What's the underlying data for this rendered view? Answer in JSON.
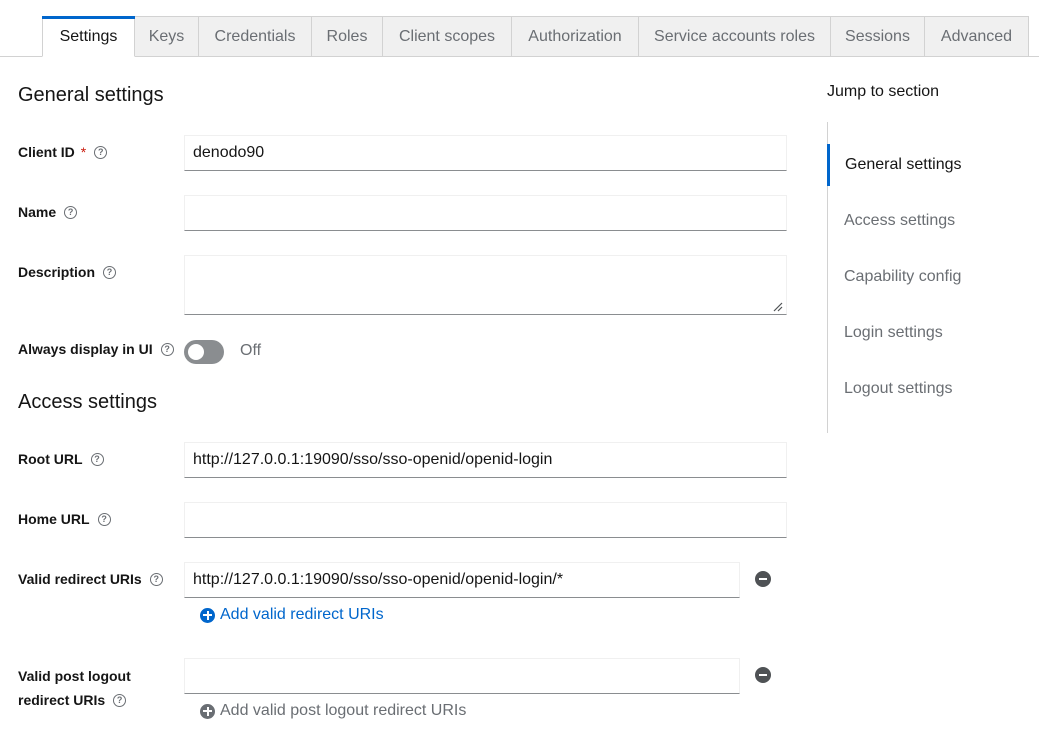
{
  "tabs": [
    {
      "label": "Settings",
      "active": true
    },
    {
      "label": "Keys"
    },
    {
      "label": "Credentials"
    },
    {
      "label": "Roles"
    },
    {
      "label": "Client scopes"
    },
    {
      "label": "Authorization"
    },
    {
      "label": "Service accounts roles"
    },
    {
      "label": "Sessions"
    },
    {
      "label": "Advanced"
    }
  ],
  "general": {
    "title": "General settings",
    "client_id": {
      "label": "Client ID",
      "required_mark": "*",
      "value": "denodo90"
    },
    "name": {
      "label": "Name",
      "value": ""
    },
    "description": {
      "label": "Description",
      "value": ""
    },
    "always_display": {
      "label": "Always display in UI",
      "state": "Off"
    }
  },
  "access": {
    "title": "Access settings",
    "root_url": {
      "label": "Root URL",
      "value": "http://127.0.0.1:19090/sso/sso-openid/openid-login"
    },
    "home_url": {
      "label": "Home URL",
      "value": ""
    },
    "redirect_uris": {
      "label": "Valid redirect URIs",
      "value": "http://127.0.0.1:19090/sso/sso-openid/openid-login/*",
      "add_label": "Add valid redirect URIs"
    },
    "post_logout": {
      "label_line1": "Valid post logout",
      "label_line2": "redirect URIs",
      "value": "",
      "add_label": "Add valid post logout redirect URIs"
    }
  },
  "jump": {
    "title": "Jump to section",
    "items": [
      {
        "label": "General settings",
        "active": true
      },
      {
        "label": "Access settings"
      },
      {
        "label": "Capability config"
      },
      {
        "label": "Login settings"
      },
      {
        "label": "Logout settings"
      }
    ]
  },
  "help_glyph": "?",
  "icons": {
    "help": "question-circle-icon",
    "remove": "minus-circle-icon",
    "add": "plus-circle-icon",
    "resize": "resize-grip-icon"
  },
  "colors": {
    "accent": "#0066cc",
    "required": "#c9190b",
    "muted": "#6a6e73",
    "tab_bg": "#f0f0f0",
    "toggle_off": "#8a8d90"
  }
}
